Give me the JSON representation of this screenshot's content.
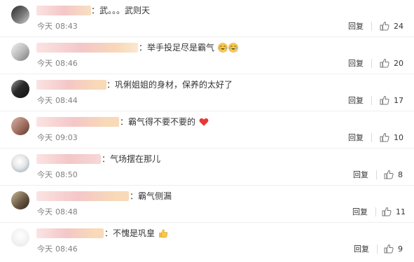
{
  "comments": [
    {
      "text": "：武。。。武则天",
      "date": "今天",
      "time": "08:43",
      "reply": "回复",
      "likes": "24",
      "emoji": []
    },
    {
      "text": "：举手投足尽是霸气",
      "date": "今天",
      "time": "08:46",
      "reply": "回复",
      "likes": "20",
      "emoji": [
        "crying-laughing",
        "crying-laughing"
      ]
    },
    {
      "text": "：巩俐姐姐的身材，保养的太好了",
      "date": "今天",
      "time": "08:44",
      "reply": "回复",
      "likes": "17",
      "emoji": []
    },
    {
      "text": "：霸气得不要不要的",
      "date": "今天",
      "time": "09:03",
      "reply": "回复",
      "likes": "10",
      "emoji": [
        "red-heart"
      ]
    },
    {
      "text": "：气场摆在那儿",
      "date": "今天",
      "time": "08:50",
      "reply": "回复",
      "likes": "8",
      "emoji": []
    },
    {
      "text": "：霸气侧漏",
      "date": "今天",
      "time": "08:48",
      "reply": "回复",
      "likes": "11",
      "emoji": []
    },
    {
      "text": "：不愧是巩皇",
      "date": "今天",
      "time": "08:46",
      "reply": "回复",
      "likes": "9",
      "emoji": [
        "thumbs-up"
      ]
    }
  ],
  "colors": {
    "text": "#333333",
    "meta": "#808080",
    "divider": "#eeeeee",
    "blurred_username": "#f4c7c7",
    "heart": "#e53935",
    "emoji_yellow": "#f8c84a"
  }
}
